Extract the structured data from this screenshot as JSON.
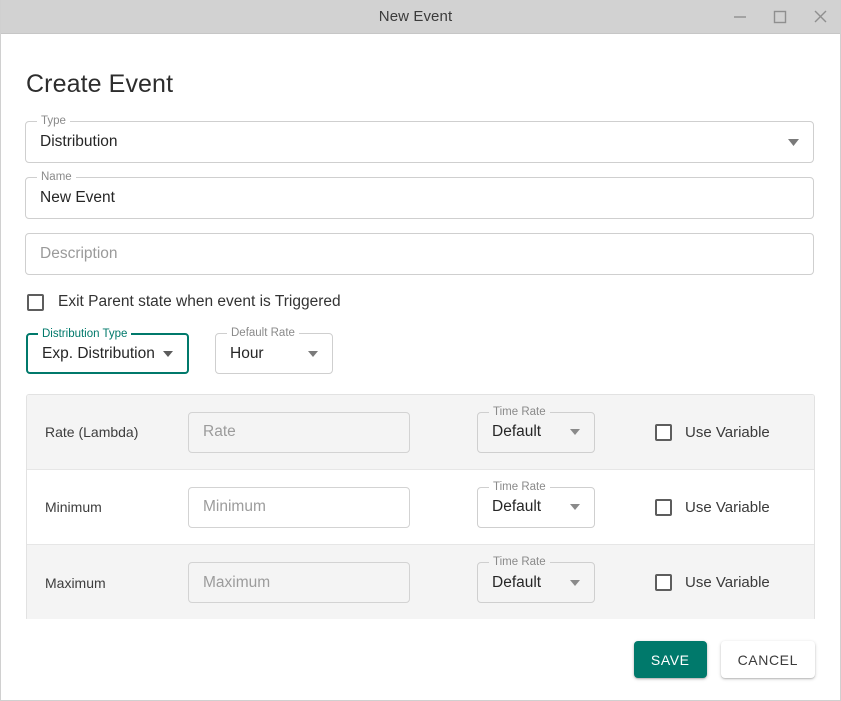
{
  "window": {
    "title": "New Event",
    "controls": {
      "minimize": "minimize-icon",
      "maximize": "maximize-icon",
      "close": "close-icon"
    }
  },
  "page": {
    "heading": "Create Event"
  },
  "fields": {
    "type": {
      "label": "Type",
      "value": "Distribution",
      "icon": "chevron-down-icon"
    },
    "name": {
      "label": "Name",
      "value": "New Event"
    },
    "description": {
      "placeholder": "Description",
      "value": ""
    },
    "exit_parent": {
      "label": "Exit Parent state when event is Triggered",
      "checked": false
    },
    "distribution_type": {
      "label": "Distribution Type",
      "value": "Exp. Distribution",
      "focused": true,
      "icon": "chevron-down-icon"
    },
    "default_rate": {
      "label": "Default Rate",
      "value": "Hour",
      "icon": "chevron-down-icon"
    }
  },
  "parameters": {
    "time_rate_label": "Time Rate",
    "use_variable_label": "Use Variable",
    "rows": [
      {
        "label": "Rate (Lambda)",
        "placeholder": "Rate",
        "value": "",
        "time_rate": "Default",
        "use_variable": false
      },
      {
        "label": "Minimum",
        "placeholder": "Minimum",
        "value": "",
        "time_rate": "Default",
        "use_variable": false
      },
      {
        "label": "Maximum",
        "placeholder": "Maximum",
        "value": "",
        "time_rate": "Default",
        "use_variable": false
      }
    ]
  },
  "footer": {
    "save_label": "SAVE",
    "cancel_label": "CANCEL"
  },
  "colors": {
    "accent": "#00796b",
    "titlebar": "#d2d2d2",
    "row_alt": "#f4f4f4",
    "border": "#cfcfcf"
  }
}
